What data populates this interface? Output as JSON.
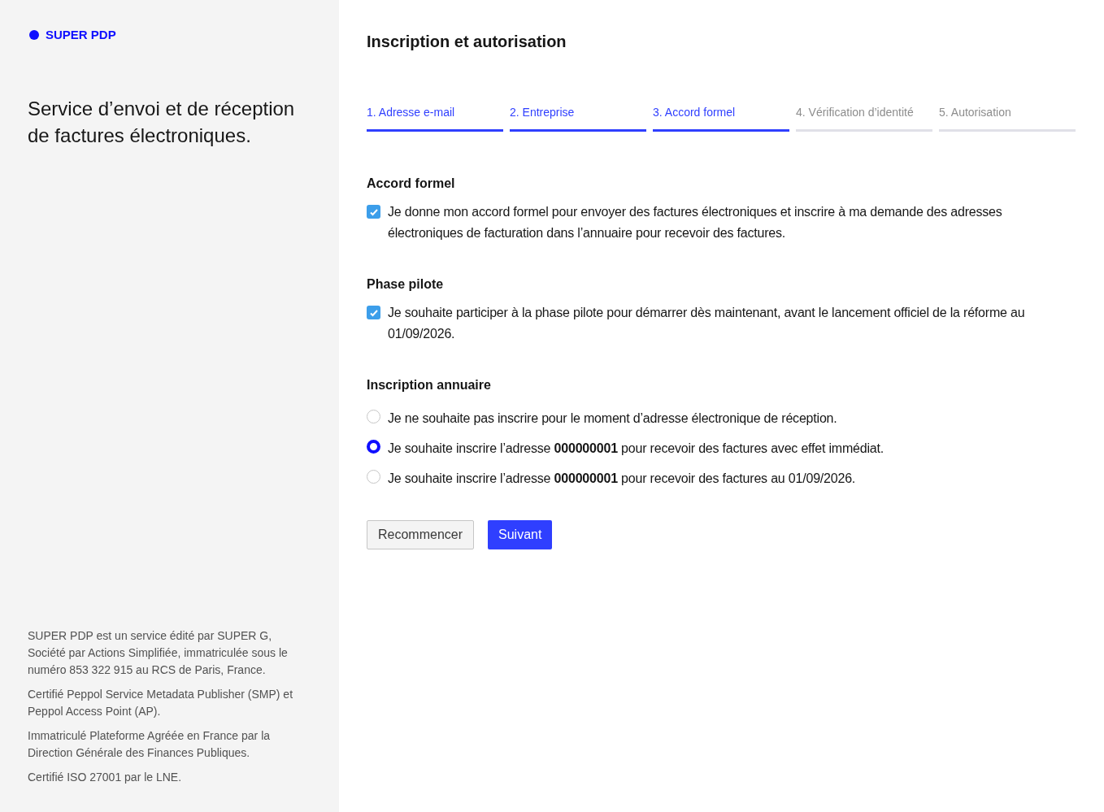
{
  "brand": {
    "name": "SUPER PDP"
  },
  "tagline": "Service d’envoi et de réception de factures électroniques.",
  "legal": [
    "SUPER PDP est un service édité par SUPER G, Société par Actions Simplifiée, immatriculée sous le numéro 853 322 915 au RCS de Paris, France.",
    "Certifié Peppol Service Metadata Publisher (SMP) et Peppol Access Point (AP).",
    "Immatriculé Plateforme Agréée en France par la Direction Générale des Finances Publiques.",
    "Certifié ISO 27001 par le LNE."
  ],
  "title": "Inscription et autorisation",
  "steps": [
    {
      "label": "1. Adresse e-mail",
      "reached": true
    },
    {
      "label": "2. Entreprise",
      "reached": true
    },
    {
      "label": "3. Accord formel",
      "reached": true
    },
    {
      "label": "4. Vérification d’identité",
      "reached": false
    },
    {
      "label": "5. Autorisation",
      "reached": false
    }
  ],
  "sections": [
    {
      "heading": "Accord formel",
      "kind": "checkbox",
      "options": [
        {
          "label": "Je donne mon accord formel pour envoyer des factures électroniques et inscrire à ma demande des adresses électroniques de facturation dans l’annuaire pour recevoir des factures.",
          "checked": true
        }
      ]
    },
    {
      "heading": "Phase pilote",
      "kind": "checkbox",
      "options": [
        {
          "label": "Je souhaite participer à la phase pilote pour démarrer dès maintenant, avant le lancement officiel de la réforme au 01/09/2026.",
          "checked": true
        }
      ]
    },
    {
      "heading": "Inscription annuaire",
      "kind": "radio",
      "options": [
        {
          "label": "Je ne souhaite pas inscrire pour le moment d’adresse électronique de réception.",
          "selected": false
        },
        {
          "label": "Je souhaite inscrire l’adresse **000000001** pour recevoir des factures avec effet immédiat.",
          "selected": true
        },
        {
          "label": "Je souhaite inscrire l’adresse **000000001** pour recevoir des factures au 01/09/2026.",
          "selected": false
        }
      ]
    }
  ],
  "buttons": [
    {
      "label": "Recommencer",
      "kind": "secondary"
    },
    {
      "label": "Suivant",
      "kind": "primary"
    }
  ]
}
